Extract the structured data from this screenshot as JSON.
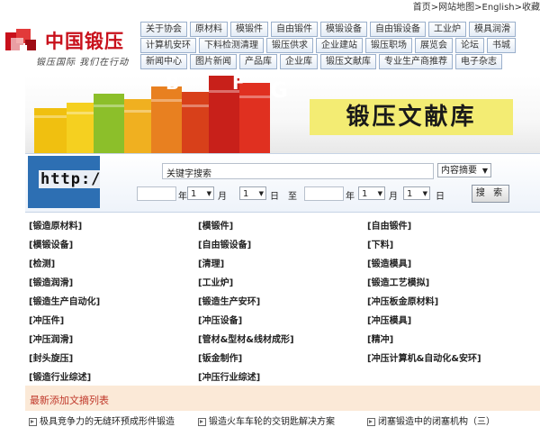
{
  "topbar": {
    "links": "首页>网站地图>English>收藏"
  },
  "logo": {
    "name": "中国锻压",
    "slogan": "锻压国际 我们在行动"
  },
  "nav": {
    "row1": [
      "关于协会",
      "原材料",
      "模锻件",
      "自由锻件",
      "模锻设备",
      "自由锻设备",
      "工业炉",
      "模具润滑"
    ],
    "row2": [
      "计算机安环",
      "下料检测清理",
      "锻压供求",
      "企业建站",
      "锻压职场",
      "展览会",
      "论坛",
      "书城"
    ],
    "row3": [
      "新闻中心",
      "图片新闻",
      "产品库",
      "企业库",
      "锻压文献库",
      "专业生产商推荐",
      "电子杂志"
    ]
  },
  "banner": {
    "title": "锻压文献库",
    "letters": [
      "B",
      "F",
      "G"
    ]
  },
  "search": {
    "image_text": "http://",
    "keyword_label": "关键字搜索",
    "scope": "内容摘要",
    "year_label": "年",
    "month_label": "月",
    "day_label": "日",
    "to_label": "至",
    "from_month": "1",
    "from_day": "1",
    "to_month": "1",
    "to_day": "1",
    "button": "搜 索"
  },
  "categories": [
    [
      "[锻造原材料]",
      "[模锻件]",
      "[自由锻件]"
    ],
    [
      "[模锻设备]",
      "[自由锻设备]",
      "[下料]"
    ],
    [
      "[检测]",
      "[清理]",
      "[锻造模具]"
    ],
    [
      "[锻造润滑]",
      "[工业炉]",
      "[锻造工艺模拟]"
    ],
    [
      "[锻造生产自动化]",
      "[锻造生产安环]",
      "[冲压板金原材料]"
    ],
    [
      "[冲压件]",
      "[冲压设备]",
      "[冲压模具]"
    ],
    [
      "[冲压润滑]",
      "[管材&型材&线材成形]",
      "[精冲]"
    ],
    [
      "[封头旋压]",
      "[钣金制作]",
      "[冲压计算机&自动化&安环]"
    ],
    [
      "[锻造行业综述]",
      "[冲压行业综述]",
      ""
    ]
  ],
  "latest": {
    "heading": "最新添加文摘列表",
    "items": [
      "极具竞争力的无缝环预成形件锻造",
      "锻造火车车轮的交钥匙解决方案",
      "闭塞锻造中的闭塞机构（三）"
    ]
  },
  "colors": {
    "brand_red": "#c8101b",
    "nav_border": "#9bb0cc",
    "banner_title_bg": "#f3ec73",
    "latest_bg": "#fbe9d7",
    "latest_head": "#c0392b"
  }
}
